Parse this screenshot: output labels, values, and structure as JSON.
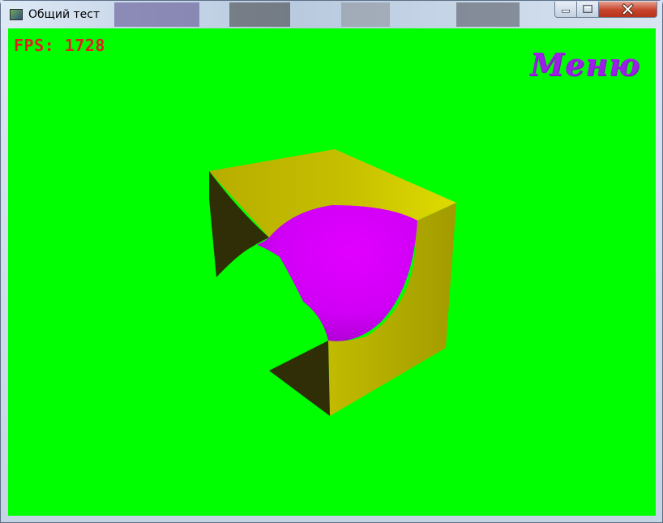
{
  "window": {
    "title": "Общий тест",
    "controls": [
      "minimize-icon",
      "maximize-icon",
      "close-icon"
    ]
  },
  "hud": {
    "fps_label": "FPS: 1728",
    "menu_label": "Меню"
  },
  "scene": {
    "object": "cube-with-spherical-cutout",
    "colors": {
      "background": "#00ff00",
      "cube_top": "#c9c200",
      "cube_side": "#a9a300",
      "cube_inner_shadow": "#302e06",
      "cutout_surface": "#d600ff",
      "fps_text": "#e02020",
      "menu_text": "#9b1fe6"
    }
  }
}
